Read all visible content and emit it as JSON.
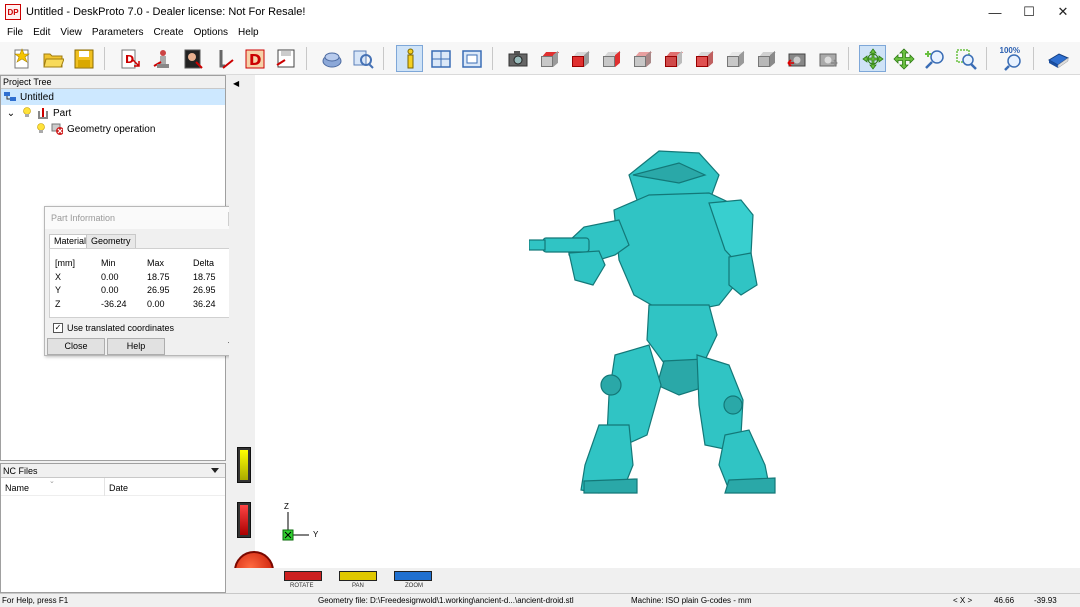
{
  "window": {
    "title": "Untitled - DeskProto 7.0 - Dealer license: Not For Resale!",
    "icon_text": "DP"
  },
  "menu": [
    "File",
    "Edit",
    "View",
    "Parameters",
    "Create",
    "Options",
    "Help"
  ],
  "project_tree": {
    "header": "Project Tree",
    "root": "Untitled",
    "part": "Part",
    "operation": "Geometry operation"
  },
  "part_info": {
    "title": "Part Information",
    "tabs": [
      "Material",
      "Geometry"
    ],
    "columns": [
      "[mm]",
      "Min",
      "Max",
      "Delta"
    ],
    "rows": [
      {
        "axis": "X",
        "min": "0.00",
        "max": "18.75",
        "delta": "18.75"
      },
      {
        "axis": "Y",
        "min": "0.00",
        "max": "26.95",
        "delta": "26.95"
      },
      {
        "axis": "Z",
        "min": "-36.24",
        "max": "0.00",
        "delta": "36.24"
      }
    ],
    "checkbox_label": "Use translated coordinates",
    "checkbox_checked": true,
    "buttons": [
      "Close",
      "Help"
    ]
  },
  "nc_files": {
    "header": "NC Files",
    "columns": [
      "Name",
      "Date"
    ]
  },
  "viewport": {
    "axis_labels": {
      "z": "Z",
      "y": "Y"
    },
    "mouse_modes": [
      "ROTATE",
      "PAN",
      "ZOOM"
    ],
    "model_color": "#30c4c4"
  },
  "status": {
    "help": "For Help, press F1",
    "geometry_file": "Geometry file: D:\\Freedesignwold\\1.working\\ancient-d...\\ancient-droid.stl",
    "machine": "Machine: ISO plain G-codes - mm",
    "coord_label": "< X >",
    "coord_x": "46.66",
    "coord_y": "-39.93"
  },
  "toolbar": {
    "zoom_label": "100%"
  }
}
